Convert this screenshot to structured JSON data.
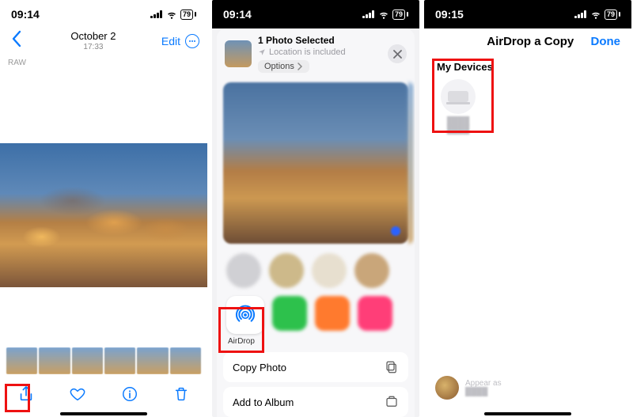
{
  "screen1": {
    "statusbar": {
      "time": "09:14",
      "battery": "79"
    },
    "header": {
      "date": "October 2",
      "time": "17:33",
      "edit": "Edit"
    },
    "raw_badge": "RAW",
    "toolbar_hint": "share"
  },
  "screen2": {
    "statusbar": {
      "time": "09:14",
      "battery": "79"
    },
    "sheet": {
      "selected_label": "1 Photo Selected",
      "location_hint": "Location is included",
      "options": "Options",
      "airdrop_label": "AirDrop",
      "actions": {
        "copy": "Copy Photo",
        "add_album": "Add to Album"
      }
    }
  },
  "screen3": {
    "statusbar": {
      "time": "09:15",
      "battery": "79"
    },
    "title": "AirDrop a Copy",
    "done": "Done",
    "section_my_devices": "My Devices",
    "appear_as_label": "Appear as"
  }
}
